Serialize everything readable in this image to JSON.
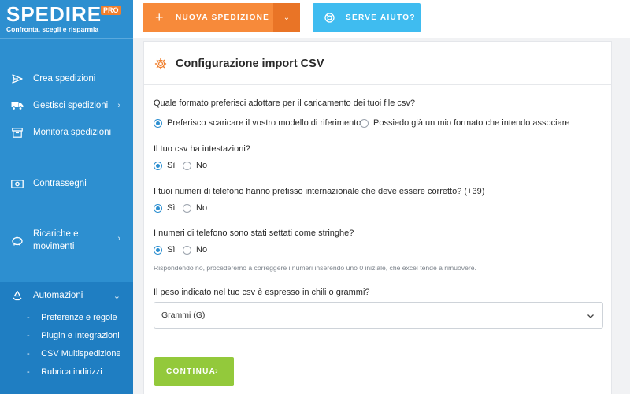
{
  "brand": {
    "logo": "SPEDIRE",
    "badge": "PRO",
    "tagline": "Confronta, scegli e risparmia"
  },
  "sidebar": {
    "items": [
      {
        "label": "Crea spedizioni",
        "icon": "paper-plane-icon"
      },
      {
        "label": "Gestisci spedizioni",
        "icon": "truck-icon",
        "chevron": "›"
      },
      {
        "label": "Monitora spedizioni",
        "icon": "archive-box-icon"
      },
      {
        "label": "Contrassegni",
        "icon": "banknote-icon"
      },
      {
        "label_line1": "Ricariche e",
        "label_line2": "movimenti",
        "icon": "piggy-bank-icon",
        "chevron": "›"
      },
      {
        "label": "Automazioni",
        "icon": "recycle-icon",
        "chevron": "⌄"
      }
    ],
    "sub_items": [
      {
        "label": "Preferenze e regole"
      },
      {
        "label": "Plugin e Integrazioni"
      },
      {
        "label": "CSV Multispedizione"
      },
      {
        "label": "Rubrica indirizzi"
      }
    ],
    "sub_prefix": "-"
  },
  "header": {
    "new_shipment_plus": "+",
    "new_shipment_label": "NUOVA SPEDIZIONE",
    "new_shipment_dropdown": "⌄",
    "help_label": "SERVE AIUTO?"
  },
  "card": {
    "title": "Configurazione import CSV",
    "questions": [
      {
        "text": "Quale formato preferisci adottare per il caricamento dei tuoi file csv?",
        "options": [
          "Preferisco scaricare il vostro modello di riferimento",
          "Possiedo già un mio formato che intendo associare"
        ],
        "selected": 0
      },
      {
        "text": "Il tuo csv ha intestazioni?",
        "options": [
          "Sì",
          "No"
        ],
        "selected": 0
      },
      {
        "text": "I tuoi numeri di telefono hanno prefisso internazionale che deve essere corretto? (+39)",
        "options": [
          "Sì",
          "No"
        ],
        "selected": 0
      },
      {
        "text": "I numeri di telefono sono stati settati come stringhe?",
        "options": [
          "Sì",
          "No"
        ],
        "selected": 0
      }
    ],
    "hint": "Rispondendo no, procederemo a correggere i numeri inserendo uno 0 iniziale, che excel tende a rimuovere.",
    "weight_question": "Il peso indicato nel tuo csv è espresso in chili o grammi?",
    "weight_selected": "Grammi (G)",
    "continue_label": "CONTINUA",
    "continue_arrow": "›"
  },
  "colors": {
    "sidebar": "#2d8fd0",
    "sidebar_active": "#1f7ec2",
    "new_button": "#f78a3a",
    "help_button": "#3fbcf0",
    "continue_button": "#93c93b",
    "accent_icon": "#f07f2d"
  }
}
